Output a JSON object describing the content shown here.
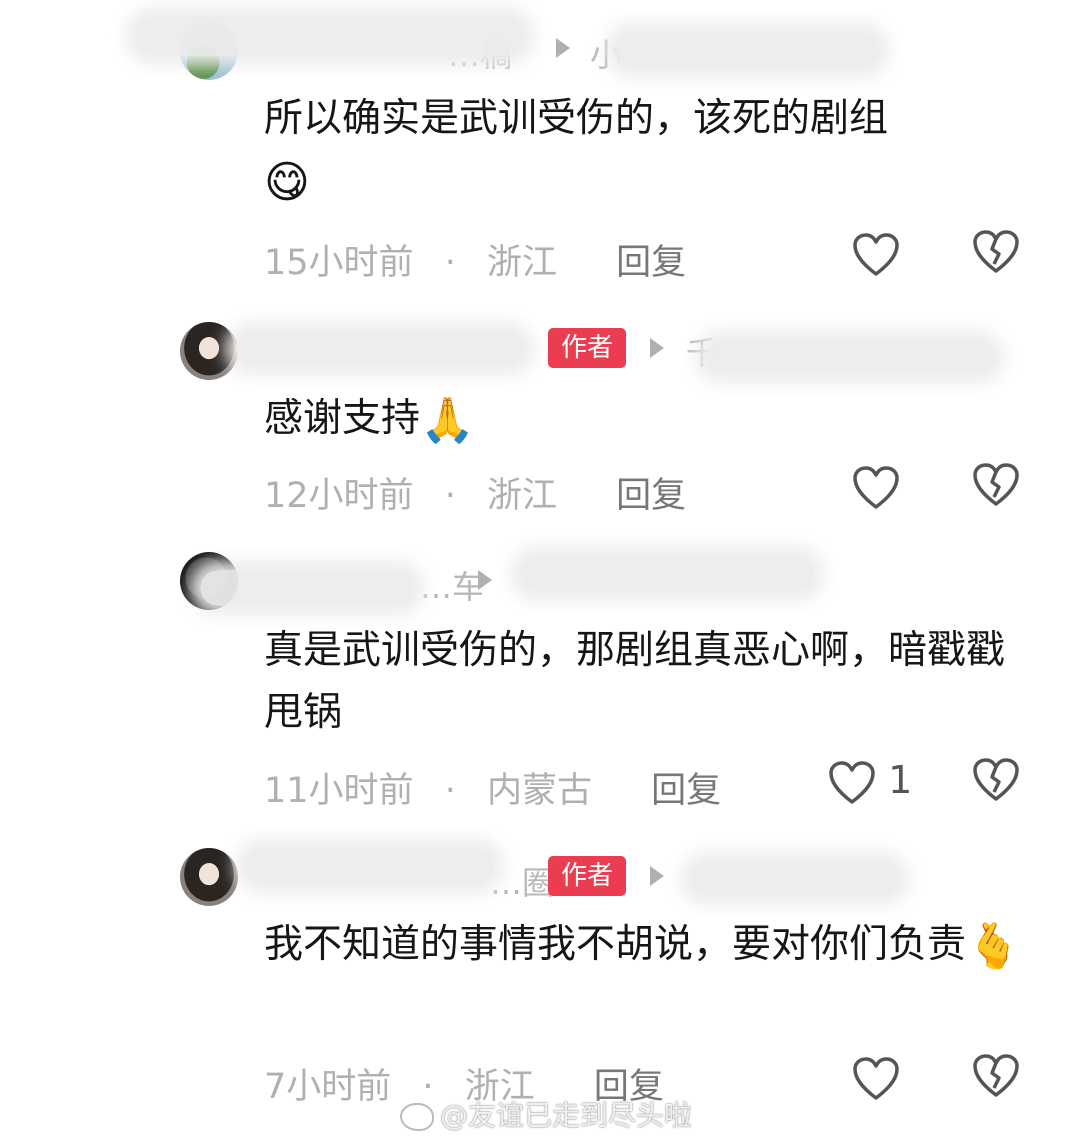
{
  "comments": [
    {
      "name_partial": "…稿",
      "reply_to_partial": "小",
      "text": "所以确实是武训受伤的，该死的剧组",
      "emoji": "😋",
      "time": "15小时前",
      "location": "浙江",
      "reply_label": "回复",
      "likes": ""
    },
    {
      "name_partial": "",
      "author_badge": "作者",
      "reply_to_partial": "千",
      "text": "感谢支持",
      "emoji": "🙏",
      "time": "12小时前",
      "location": "浙江",
      "reply_label": "回复",
      "likes": ""
    },
    {
      "name_partial": "…车",
      "reply_to_partial": "",
      "text": "真是武训受伤的，那剧组真恶心啊，暗戳戳甩锅",
      "emoji": "",
      "time": "11小时前",
      "location": "内蒙古",
      "reply_label": "回复",
      "likes": "1"
    },
    {
      "name_partial": "…圈",
      "author_badge": "作者",
      "reply_to_partial": "",
      "text": "我不知道的事情我不胡说，要对你们负责",
      "emoji": "🫰",
      "time": "7小时前",
      "location": "浙江",
      "reply_label": "回复",
      "likes": ""
    }
  ],
  "separator": "·",
  "watermark": "@友谊已走到尽头啦",
  "colors": {
    "badge": "#ec3c52",
    "meta": "#b0b0b0"
  },
  "icons": {
    "like": "heart-outline-icon",
    "dislike": "broken-heart-icon"
  }
}
